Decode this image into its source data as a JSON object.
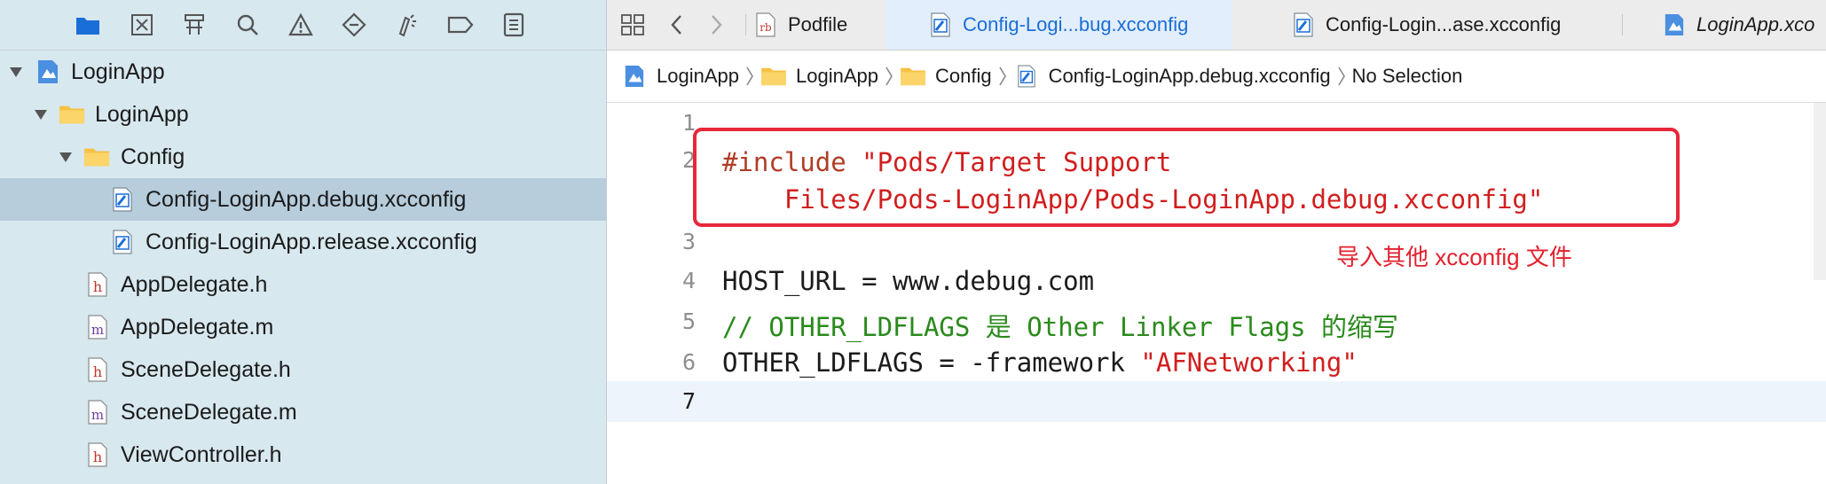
{
  "navigator": {
    "toolbar_icons": [
      "folder-icon",
      "source-control-icon",
      "hierarchy-icon",
      "search-icon",
      "warning-icon",
      "test-icon",
      "debug-icon",
      "breakpoint-icon",
      "report-icon"
    ],
    "tree": [
      {
        "label": "LoginApp",
        "icon": "project-icon",
        "level": 0,
        "disclosure": "open"
      },
      {
        "label": "LoginApp",
        "icon": "folder-icon",
        "level": 1,
        "disclosure": "open"
      },
      {
        "label": "Config",
        "icon": "folder-icon",
        "level": 2,
        "disclosure": "open"
      },
      {
        "label": "Config-LoginApp.debug.xcconfig",
        "icon": "xcconfig-icon",
        "level": 3,
        "selected": true
      },
      {
        "label": "Config-LoginApp.release.xcconfig",
        "icon": "xcconfig-icon",
        "level": 3
      },
      {
        "label": "AppDelegate.h",
        "icon": "h-file-icon",
        "level": 2
      },
      {
        "label": "AppDelegate.m",
        "icon": "m-file-icon",
        "level": 2
      },
      {
        "label": "SceneDelegate.h",
        "icon": "h-file-icon",
        "level": 2
      },
      {
        "label": "SceneDelegate.m",
        "icon": "m-file-icon",
        "level": 2
      },
      {
        "label": "ViewController.h",
        "icon": "h-file-icon",
        "level": 2
      }
    ]
  },
  "tabbar": {
    "tabs": [
      {
        "label": "Podfile",
        "icon": "ruby-file-icon"
      },
      {
        "label": "Config-Logi...bug.xcconfig",
        "icon": "xcconfig-icon",
        "active": true
      },
      {
        "label": "Config-Login...ase.xcconfig",
        "icon": "xcconfig-icon"
      },
      {
        "label": "LoginApp.xco",
        "icon": "project-icon"
      }
    ]
  },
  "jumpbar": {
    "crumbs": [
      {
        "label": "LoginApp",
        "icon": "project-icon"
      },
      {
        "label": "LoginApp",
        "icon": "folder-icon"
      },
      {
        "label": "Config",
        "icon": "folder-icon"
      },
      {
        "label": "Config-LoginApp.debug.xcconfig",
        "icon": "xcconfig-icon"
      },
      {
        "label": "No Selection",
        "icon": ""
      }
    ]
  },
  "editor": {
    "line_numbers": [
      "1",
      "2",
      "3",
      "4",
      "5",
      "6",
      "7"
    ],
    "current_line": "7",
    "lines": {
      "l2a_directive": "#include ",
      "l2a_string": "\"Pods/Target Support",
      "l2b_string": "    Files/Pods-LoginApp/Pods-LoginApp.debug.xcconfig\"",
      "l4": "HOST_URL = www.debug.com",
      "l5": "// OTHER_LDFLAGS 是 Other Linker Flags 的缩写",
      "l6_plain": "OTHER_LDFLAGS = -framework ",
      "l6_string": "\"AFNetworking\""
    },
    "annotation": "导入其他 xcconfig 文件"
  },
  "colors": {
    "navigator_bg": "#d8e8ef",
    "selection": "#b7cddc",
    "active_tab_text": "#1a6ed8",
    "annotation_red": "#e3202d",
    "directive": "#b03d25",
    "string": "#d11e1e",
    "comment": "#2a8a1c"
  }
}
